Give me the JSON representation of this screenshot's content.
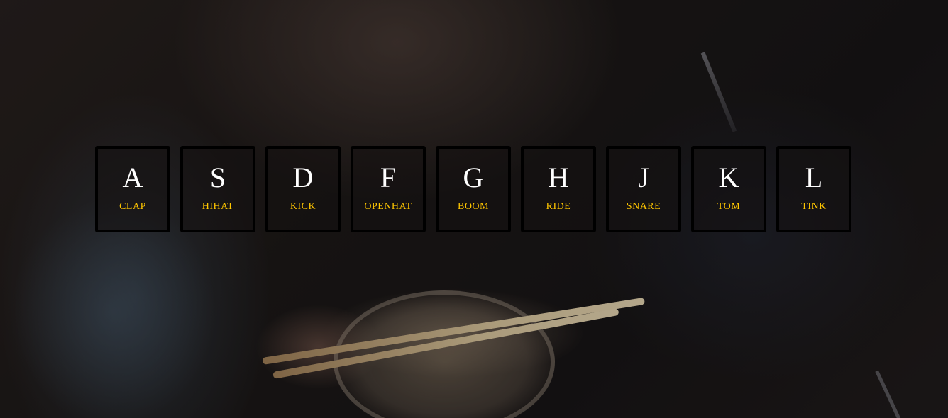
{
  "accent_color": "#ffc600",
  "key_border_color": "#000000",
  "letter_color": "#ffffff",
  "keys": [
    {
      "letter": "A",
      "sound": "CLAP"
    },
    {
      "letter": "S",
      "sound": "HIHAT"
    },
    {
      "letter": "D",
      "sound": "KICK"
    },
    {
      "letter": "F",
      "sound": "OPENHAT"
    },
    {
      "letter": "G",
      "sound": "BOOM"
    },
    {
      "letter": "H",
      "sound": "RIDE"
    },
    {
      "letter": "J",
      "sound": "SNARE"
    },
    {
      "letter": "K",
      "sound": "TOM"
    },
    {
      "letter": "L",
      "sound": "TINK"
    }
  ]
}
